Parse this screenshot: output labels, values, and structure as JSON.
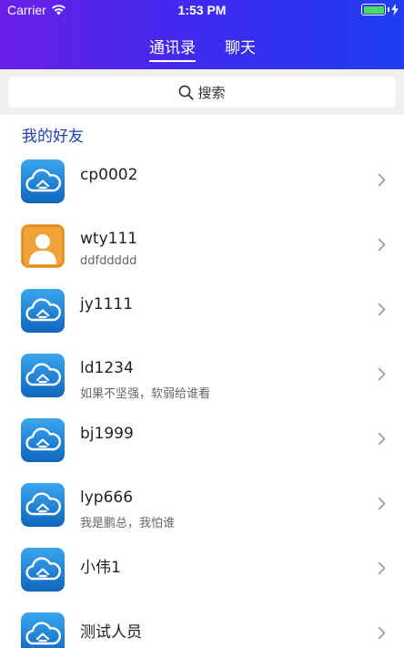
{
  "status_bar": {
    "carrier": "Carrier",
    "time": "1:53 PM",
    "battery_level": 1.0,
    "icons": [
      "wifi-icon",
      "battery-icon",
      "charging-icon"
    ]
  },
  "tabs": [
    {
      "label": "通讯录",
      "active": true
    },
    {
      "label": "聊天",
      "active": false
    }
  ],
  "search": {
    "label": "搜索",
    "icon": "search-icon"
  },
  "section_title": "我的好友",
  "friends": [
    {
      "name": "cp0002",
      "subtitle": "",
      "avatar": "cloud-avatar-icon"
    },
    {
      "name": "wty111",
      "subtitle": "ddfddddd",
      "avatar": "person-avatar-icon"
    },
    {
      "name": "jy1111",
      "subtitle": "",
      "avatar": "cloud-avatar-icon"
    },
    {
      "name": "ld1234",
      "subtitle": "如果不坚强，软弱给谁看",
      "avatar": "cloud-avatar-icon"
    },
    {
      "name": "bj1999",
      "subtitle": "",
      "avatar": "cloud-avatar-icon"
    },
    {
      "name": "lyp666",
      "subtitle": "我是鹏总，我怕谁",
      "avatar": "cloud-avatar-icon"
    },
    {
      "name": "小伟1",
      "subtitle": "",
      "avatar": "cloud-avatar-icon"
    },
    {
      "name": "测试人员",
      "subtitle": "",
      "avatar": "cloud-avatar-icon"
    }
  ],
  "colors": {
    "header_gradient_start": "#6a1fe8",
    "header_gradient_end": "#1f3ef2",
    "section_title": "#1f3fb3",
    "cloud_avatar": "#1a7fd4",
    "person_avatar": "#f0a33a",
    "battery_fill": "#4cd964"
  }
}
